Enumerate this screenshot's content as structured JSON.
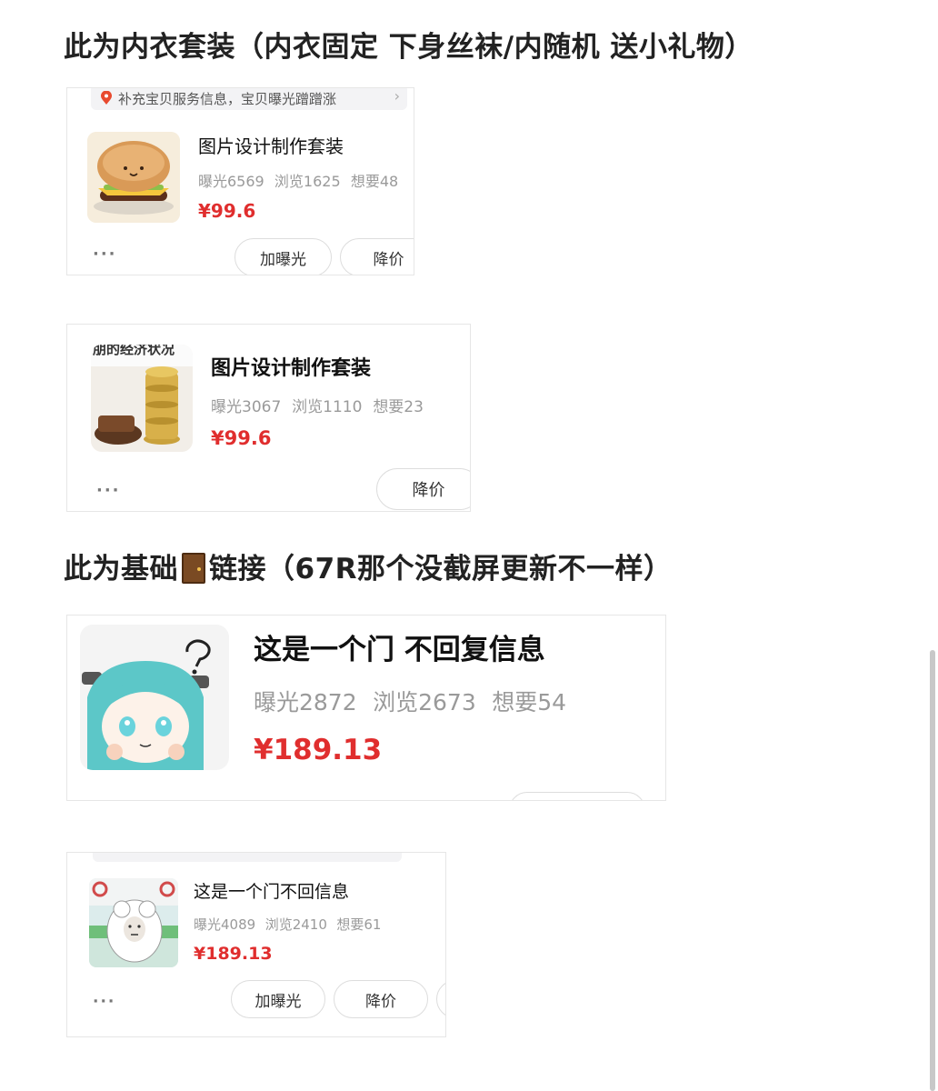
{
  "headings": {
    "top": "此为内衣套装（内衣固定 下身丝袜/内随机 送小礼物）",
    "middle_before": "此为基础",
    "middle_after": "链接（67R那个没截屏更新不一样）"
  },
  "cards": [
    {
      "notice": "补充宝贝服务信息，宝贝曝光蹭蹭涨",
      "title": "图片设计制作套装",
      "stats": [
        "曝光6569",
        "浏览1625",
        "想要48"
      ],
      "price": "¥99.6",
      "buttons": [
        "加曝光",
        "降价"
      ]
    },
    {
      "thumb_text": "朋的经济状况",
      "title": "图片设计制作套装",
      "stats": [
        "曝光3067",
        "浏览1110",
        "想要23"
      ],
      "price": "¥99.6",
      "buttons": [
        "降价"
      ]
    },
    {
      "title": "这是一个门 不回复信息",
      "stats": [
        "曝光2872",
        "浏览2673",
        "想要54"
      ],
      "price": "¥189.13"
    },
    {
      "title": "这是一个门不回信息",
      "stats": [
        "曝光4089",
        "浏览2410",
        "想要61"
      ],
      "price": "¥189.13",
      "buttons": [
        "加曝光",
        "降价"
      ]
    }
  ],
  "more": "···",
  "colors": {
    "price": "#e02e2e",
    "stats": "#9a9a9a",
    "accent_dot": "#e84a2f"
  }
}
